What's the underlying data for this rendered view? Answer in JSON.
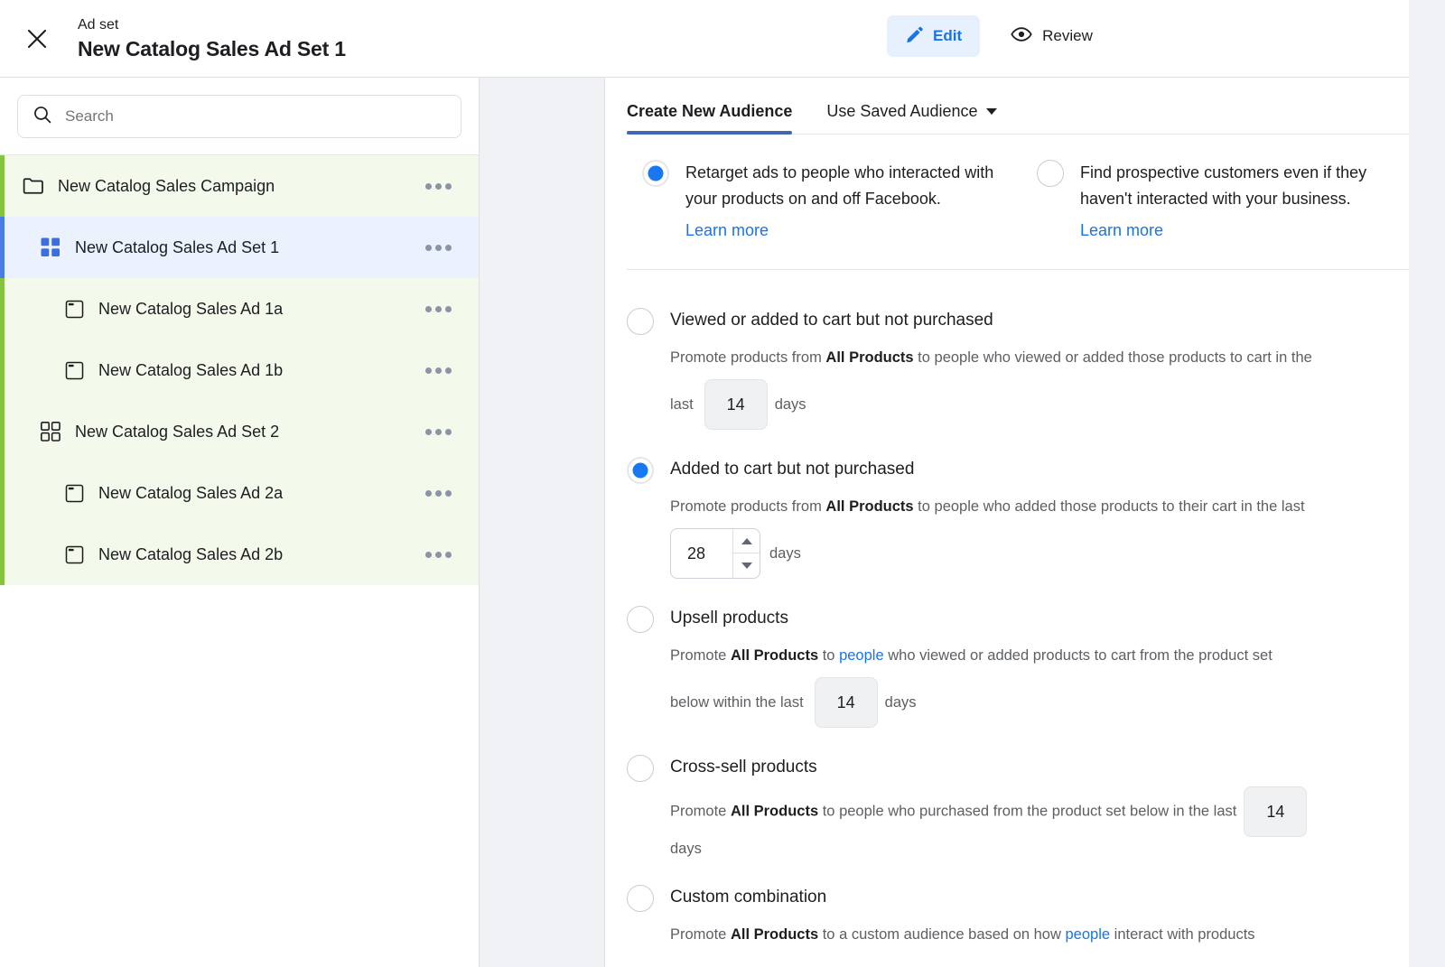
{
  "header": {
    "close_icon": "close-icon",
    "kicker": "Ad set",
    "title": "New Catalog Sales Ad Set 1",
    "edit_label": "Edit",
    "edit_icon": "pencil-icon",
    "review_label": "Review",
    "review_icon": "eye-icon",
    "edit_bg": "#e7f0fd",
    "edit_fg": "#1b74e4"
  },
  "sidebar": {
    "search": {
      "placeholder": "Search",
      "value": "",
      "icon": "search-icon"
    },
    "tree": [
      {
        "label": "New Catalog Sales Campaign",
        "icon": "folder-icon",
        "level": 0,
        "type": "campaign",
        "selected": false,
        "menu": "more-options"
      },
      {
        "label": "New Catalog Sales Ad Set 1",
        "icon": "adset-filled-icon",
        "level": 1,
        "type": "adset",
        "selected": true,
        "menu": "more-options"
      },
      {
        "label": "New Catalog Sales Ad 1a",
        "icon": "ad-icon",
        "level": 2,
        "type": "ad",
        "selected": false,
        "menu": "more-options"
      },
      {
        "label": "New Catalog Sales Ad 1b",
        "icon": "ad-icon",
        "level": 2,
        "type": "ad",
        "selected": false,
        "menu": "more-options"
      },
      {
        "label": "New Catalog Sales Ad Set 2",
        "icon": "adset-outline-icon",
        "level": 1,
        "type": "adset",
        "selected": false,
        "menu": "more-options"
      },
      {
        "label": "New Catalog Sales Ad 2a",
        "icon": "ad-icon",
        "level": 2,
        "type": "ad",
        "selected": false,
        "menu": "more-options"
      },
      {
        "label": "New Catalog Sales Ad 2b",
        "icon": "ad-icon",
        "level": 2,
        "type": "ad",
        "selected": false,
        "menu": "more-options"
      }
    ],
    "accent_campaign": "#86c440",
    "accent_selected": "#4a7ce8"
  },
  "main": {
    "tabs": [
      {
        "label": "Create New Audience",
        "active": true
      },
      {
        "label": "Use Saved Audience",
        "active": false,
        "caret": "chevron-down-icon"
      }
    ],
    "top_choices": [
      {
        "selected": true,
        "text": "Retarget ads to people who interacted with your products on and off Facebook.",
        "learn_more": "Learn more"
      },
      {
        "selected": false,
        "text": "Find prospective customers even if they haven't interacted with your business.",
        "learn_more": "Learn more"
      }
    ],
    "options": [
      {
        "id": "viewed-or-added-to-cart",
        "selected": false,
        "title": "Viewed or added to cart but not purchased",
        "desc_1": "Promote products from ",
        "desc_bold": "All Products",
        "desc_2": " to people who viewed or added those products to cart in the",
        "pre_label": "last",
        "days_value": "14",
        "days_label": "days",
        "input_style": "static"
      },
      {
        "id": "added-to-cart",
        "selected": true,
        "title": "Added to cart but not purchased",
        "desc_1": "Promote products from ",
        "desc_bold": "All Products",
        "desc_2": " to people who added those products to their cart in the last",
        "pre_label": "",
        "days_value": "28",
        "days_label": "days",
        "input_style": "spinner"
      },
      {
        "id": "upsell-products",
        "selected": false,
        "title": "Upsell products",
        "desc_1": "Promote ",
        "desc_bold": "All Products",
        "desc_2": " to ",
        "desc_link": "people",
        "desc_3": " who viewed or added products to cart from the product set",
        "pre_label": "below within the last",
        "days_value": "14",
        "days_label": "days",
        "input_style": "static"
      },
      {
        "id": "cross-sell-products",
        "selected": false,
        "title": "Cross-sell products",
        "desc_1": "Promote ",
        "desc_bold": "All Products",
        "desc_2": " to people who purchased from the product set below in the last",
        "pre_label": "",
        "days_value": "14",
        "days_label": "days",
        "input_style": "static-inline-right"
      },
      {
        "id": "custom-combination",
        "selected": false,
        "title": "Custom combination",
        "desc_1": "Promote ",
        "desc_bold": "All Products",
        "desc_2": " to a custom audience based on how ",
        "desc_link": "people",
        "desc_3": " interact with products",
        "input_style": "none"
      }
    ]
  }
}
